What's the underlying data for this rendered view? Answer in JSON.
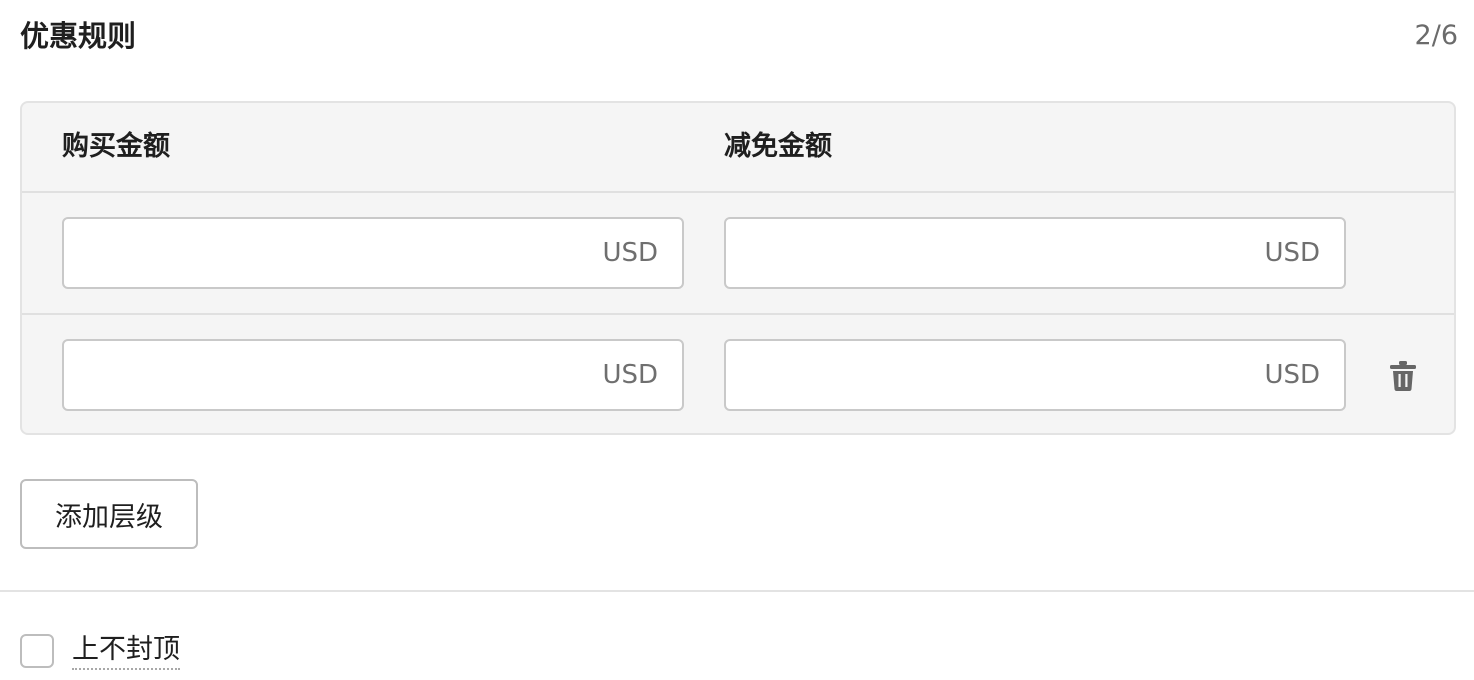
{
  "section": {
    "title": "优惠规则",
    "tier_count": "2/6"
  },
  "columns": {
    "purchase_amount": "购买金额",
    "discount_amount": "减免金额"
  },
  "tiers": [
    {
      "purchase": {
        "value": "",
        "currency": "USD"
      },
      "discount": {
        "value": "",
        "currency": "USD"
      }
    },
    {
      "purchase": {
        "value": "",
        "currency": "USD"
      },
      "discount": {
        "value": "",
        "currency": "USD"
      },
      "delete_icon": "trash-icon"
    }
  ],
  "actions": {
    "add_tier_label": "添加层级"
  },
  "no_cap": {
    "label": "上不封顶",
    "checked": false
  }
}
